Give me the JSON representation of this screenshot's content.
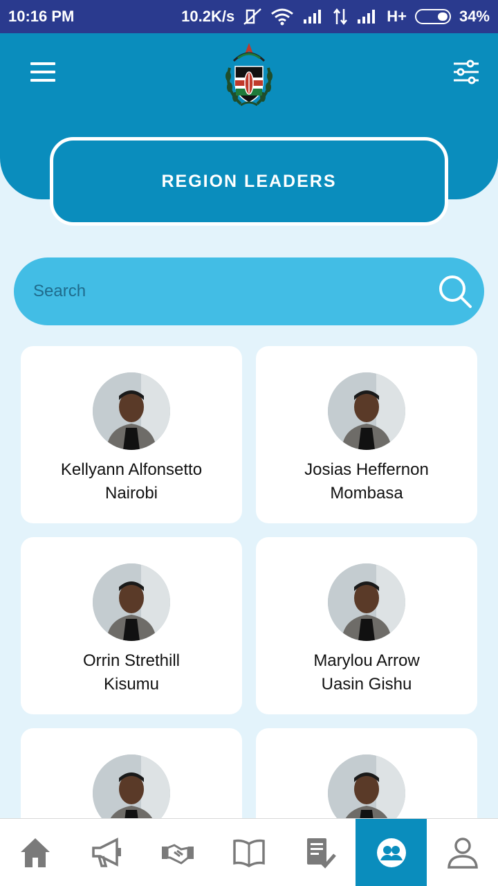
{
  "status_bar": {
    "time": "10:16 PM",
    "speed": "10.2K/s",
    "network": "H+",
    "battery": "34%",
    "icons": [
      "mute-icon",
      "wifi-icon",
      "signal-icon",
      "data-arrows-icon",
      "signal-icon",
      "battery-icon"
    ]
  },
  "header": {
    "menu_icon": "hamburger-menu-icon",
    "logo": "kenya-coat-of-arms-logo",
    "filter_icon": "sliders-filter-icon",
    "title": "REGION LEADERS"
  },
  "search": {
    "placeholder": "Search",
    "value": "",
    "icon": "search-icon"
  },
  "leaders": [
    {
      "name": "Kellyann Alfonsetto",
      "region": "Nairobi"
    },
    {
      "name": "Josias Heffernon",
      "region": "Mombasa"
    },
    {
      "name": "Orrin Strethill",
      "region": "Kisumu"
    },
    {
      "name": "Marylou Arrow",
      "region": "Uasin Gishu"
    },
    {
      "name": "",
      "region": ""
    },
    {
      "name": "",
      "region": ""
    }
  ],
  "bottom_nav": {
    "items": [
      {
        "icon": "home-icon",
        "active": false
      },
      {
        "icon": "megaphone-icon",
        "active": false
      },
      {
        "icon": "handshake-icon",
        "active": false
      },
      {
        "icon": "book-icon",
        "active": false
      },
      {
        "icon": "checklist-icon",
        "active": false
      },
      {
        "icon": "leaders-group-icon",
        "active": true
      },
      {
        "icon": "profile-icon",
        "active": false
      }
    ]
  },
  "colors": {
    "primary": "#0a8dbd",
    "search_bg": "#42bde5",
    "page_bg": "#e3f3fb",
    "status_bar": "#2a3a8e"
  }
}
